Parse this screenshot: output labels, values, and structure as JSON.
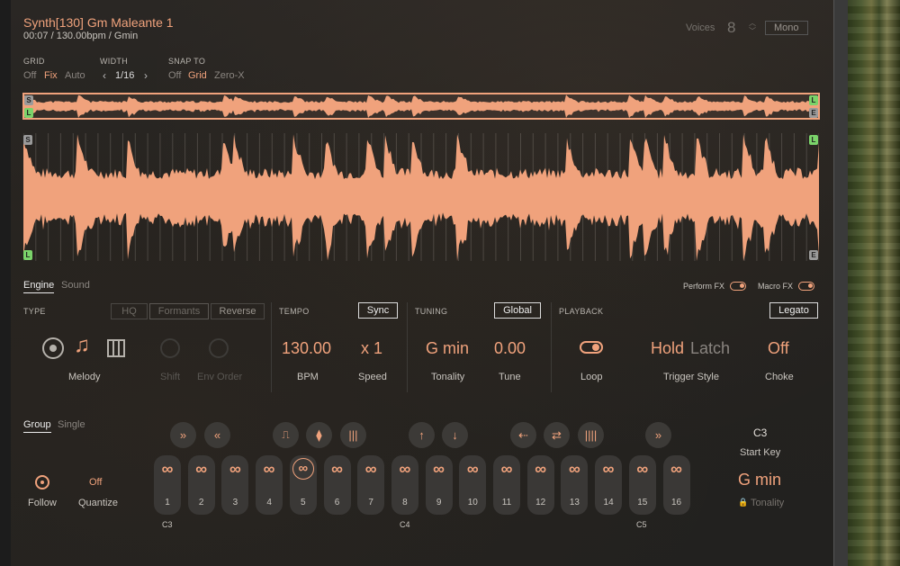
{
  "header": {
    "title": "Synth[130] Gm Maleante 1",
    "subtitle": "00:07 / 130.00bpm / Gmin",
    "voices_label": "Voices",
    "voices_value": "8",
    "mono_label": "Mono"
  },
  "grid": {
    "label": "GRID",
    "options": [
      "Off",
      "Fix",
      "Auto"
    ],
    "selected": "Fix"
  },
  "width": {
    "label": "WIDTH",
    "value": "1/16"
  },
  "snap": {
    "label": "SNAP TO",
    "options": [
      "Off",
      "Grid",
      "Zero-X"
    ],
    "selected": "Grid"
  },
  "markers": {
    "start": "S",
    "loop": "L",
    "end": "E"
  },
  "tabs": {
    "engine": "Engine",
    "sound": "Sound"
  },
  "fx": {
    "perform": "Perform FX",
    "macro": "Macro FX"
  },
  "type": {
    "label": "TYPE",
    "hq": "HQ",
    "formants": "Formants",
    "reverse": "Reverse",
    "mode_label": "Melody",
    "shift_label": "Shift",
    "env_order_label": "Env Order"
  },
  "tempo": {
    "label": "TEMPO",
    "sync": "Sync",
    "bpm_value": "130.00",
    "bpm_label": "BPM",
    "speed_value": "x 1",
    "speed_label": "Speed"
  },
  "tuning": {
    "label": "TUNING",
    "global": "Global",
    "tonality_value": "G min",
    "tonality_label": "Tonality",
    "tune_value": "0.00",
    "tune_label": "Tune"
  },
  "playback": {
    "label": "PLAYBACK",
    "legato": "Legato",
    "loop_label": "Loop",
    "trigger_hold": "Hold",
    "trigger_latch": "Latch",
    "trigger_label": "Trigger Style",
    "choke_value": "Off",
    "choke_label": "Choke"
  },
  "slices": {
    "group_tab": "Group",
    "single_tab": "Single",
    "follow_label": "Follow",
    "quantize_value": "Off",
    "quantize_label": "Quantize",
    "keys": [
      "1",
      "2",
      "3",
      "4",
      "5",
      "6",
      "7",
      "8",
      "9",
      "10",
      "11",
      "12",
      "13",
      "14",
      "15",
      "16"
    ],
    "selected_key": "5",
    "octave_labels": [
      "C3",
      "C4",
      "C5"
    ],
    "start_key_value": "C3",
    "start_key_label": "Start Key",
    "tonality_value": "G min",
    "tonality_label": "Tonality"
  },
  "colors": {
    "accent": "#f0a27c",
    "background": "#24221f",
    "loop_marker": "#7ad36a"
  }
}
